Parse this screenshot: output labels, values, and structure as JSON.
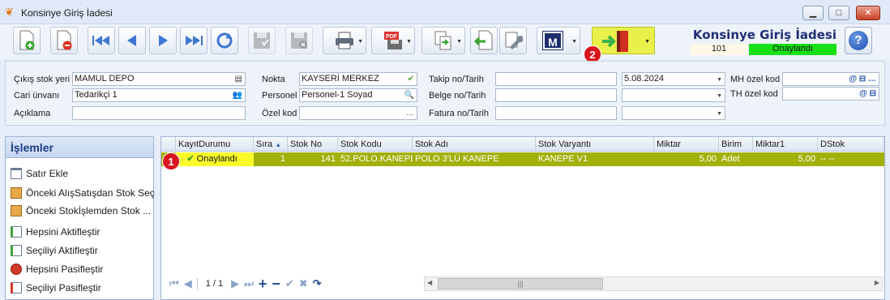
{
  "window": {
    "title": "Konsinye Giriş İadesi",
    "min_glyph": "▁",
    "max_glyph": "□",
    "close_glyph": "✕"
  },
  "header": {
    "doc_title": "Konsinye Giriş İadesi",
    "doc_no": "101",
    "status": "Onaylandı",
    "status_color": "#17e017"
  },
  "toolbar": {
    "m_label": "M",
    "exit_color": "#e9f04a",
    "icons": [
      "new-doc-icon",
      "delete-doc-icon",
      "first-record-icon",
      "prev-record-icon",
      "next-record-icon",
      "last-record-icon",
      "refresh-icon",
      "save-icon",
      "save-close-icon",
      "print-icon",
      "pdf-export-icon",
      "copy-transfer-icon",
      "import-icon",
      "settings-wrench-icon",
      "m-logo-icon",
      "exit-door-icon",
      "help-icon"
    ]
  },
  "badges": {
    "b1": "1",
    "b2": "2",
    "color": "#d9141c"
  },
  "form": {
    "cikis_stok_yeri_label": "Çıkış stok yeri",
    "cikis_stok_yeri_value": "MAMUL DEPO",
    "cari_unvani_label": "Cari ünvanı",
    "cari_unvani_value": "Tedarikçi 1",
    "aciklama_label": "Açıklama",
    "aciklama_value": "",
    "nokta_label": "Nokta",
    "nokta_value": "KAYSERİ MERKEZ",
    "personel_label": "Personel",
    "personel_value": "Personel-1 Soyad",
    "ozel_kod_label": "Özel kod",
    "ozel_kod_value": "",
    "takip_label": "Takip no/Tarih",
    "takip_value": "",
    "takip_date": "5.08.2024",
    "belge_label": "Belge no/Tarih",
    "belge_value": "",
    "belge_date": "",
    "fatura_label": "Fatura no/Tarih",
    "fatura_value": "",
    "fatura_date": "",
    "mh_label": "MH özel kod",
    "mh_value": "",
    "th_label": "TH özel kod",
    "th_value": ""
  },
  "islemler": {
    "title": "İşlemler",
    "items": [
      {
        "label": "Satır Ekle",
        "icon": "add-row-icon"
      },
      {
        "label": "Önceki AlışSatışdan Stok Seç",
        "icon": "prev-purchase-icon"
      },
      {
        "label": "Önceki Stokİşlemden Stok ...",
        "icon": "prev-stock-icon"
      },
      {
        "label": "Hepsini Aktifleştir",
        "icon": "activate-all-icon"
      },
      {
        "label": "Seçiliyi Aktifleştir",
        "icon": "activate-selected-icon"
      },
      {
        "label": "Hepsini Pasifleştir",
        "icon": "deactivate-all-icon"
      },
      {
        "label": "Seçiliyi Pasifleştir",
        "icon": "deactivate-selected-icon"
      }
    ]
  },
  "grid": {
    "columns": [
      "KayıtDurumu",
      "Sıra",
      "Stok No",
      "Stok Kodu",
      "Stok Adı",
      "Stok Varyantı",
      "Miktar",
      "Birim",
      "Miktar1",
      "DStok"
    ],
    "rows": [
      {
        "kayit_durumu": "Onaylandı",
        "sira": "1",
        "stok_no": "141",
        "stok_kodu": "52.POLO.KANEPE",
        "stok_adi": "POLO 3'LÜ KANEPE",
        "stok_varyanti": "KANEPE V1",
        "miktar": "5,00",
        "birim": "Adet",
        "miktar1": "5,00",
        "dstok": "-- --"
      }
    ],
    "row_color": "#a2b00a",
    "status_cell_color": "#fbfb2a",
    "pager": "1 / 1"
  }
}
